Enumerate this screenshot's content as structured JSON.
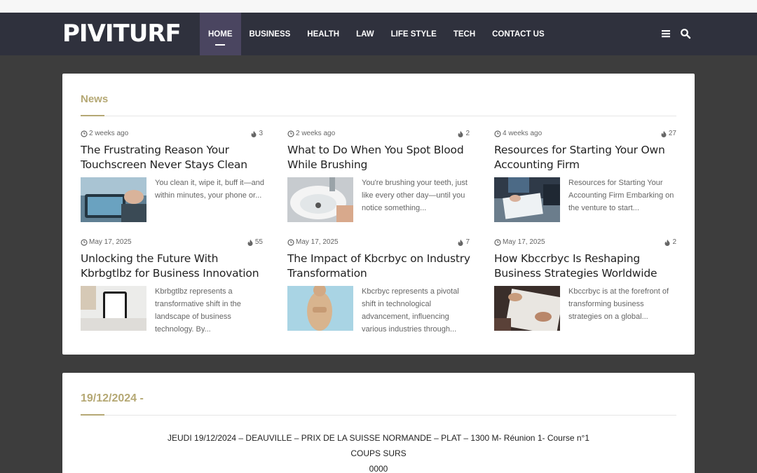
{
  "header": {
    "logo": "PIVITURF",
    "menu": [
      "HOME",
      "BUSINESS",
      "HEALTH",
      "LAW",
      "LIFE STYLE",
      "TECH",
      "CONTACT US"
    ],
    "icons": [
      "menu-icon",
      "search-icon"
    ]
  },
  "news": {
    "title": "News",
    "items": [
      {
        "date": "2 weeks ago",
        "views": "3",
        "title": "The Frustrating Reason Your Touchscreen Never Stays Clean",
        "excerpt": "You clean it, wipe it, buff it—and within minutes, your phone or..."
      },
      {
        "date": "2 weeks ago",
        "views": "2",
        "title": "What to Do When You Spot Blood While Brushing",
        "excerpt": "You're brushing your teeth, just like every other day—until you notice something..."
      },
      {
        "date": "4 weeks ago",
        "views": "27",
        "title": "Resources for Starting Your Own Accounting Firm",
        "excerpt": "Resources for Starting Your Accounting Firm Embarking on the venture to start..."
      },
      {
        "date": "May 17, 2025",
        "views": "55",
        "title": "Unlocking the Future With Kbrbgtlbz for Business Innovation",
        "excerpt": "Kbrbgtlbz represents a transformative shift in the landscape of business technology. By..."
      },
      {
        "date": "May 17, 2025",
        "views": "7",
        "title": "The Impact of Kbcrbyc on Industry Transformation",
        "excerpt": "Kbcrbyc represents a pivotal shift in technological advancement, influencing various industries through..."
      },
      {
        "date": "May 17, 2025",
        "views": "2",
        "title": "How Kbccrbyc Is Reshaping Business Strategies Worldwide",
        "excerpt": "Kbccrbyc is at the forefront of transforming business strategies on a global..."
      }
    ]
  },
  "date_section": {
    "title": "19/12/2024 -",
    "line1": "JEUDI 19/12/2024 – DEAUVILLE – PRIX DE LA SUISSE NORMANDE – PLAT – 1300 M- Réunion 1- Course n°1",
    "line2": "COUPS SURS",
    "line3": "0000"
  },
  "colors": {
    "accent": "#b5a874",
    "nav_bg": "#2f313d",
    "active_menu": "#4a4560",
    "page_bg": "#3d3d3d"
  }
}
